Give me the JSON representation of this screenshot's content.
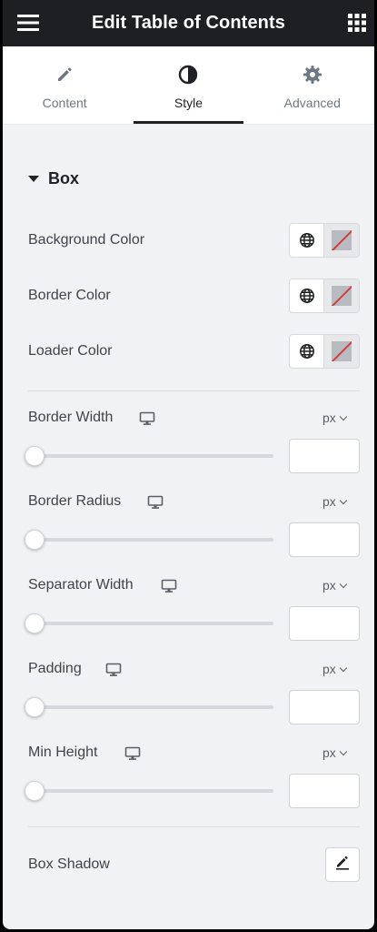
{
  "header": {
    "title": "Edit Table of Contents",
    "menu_icon": "hamburger-icon",
    "apps_icon": "grid-icon"
  },
  "tabs": [
    {
      "label": "Content",
      "icon": "pencil-icon",
      "active": false
    },
    {
      "label": "Style",
      "icon": "half-circle-icon",
      "active": true
    },
    {
      "label": "Advanced",
      "icon": "gear-icon",
      "active": false
    }
  ],
  "section": {
    "title": "Box",
    "expanded": true
  },
  "colors": [
    {
      "label": "Background Color"
    },
    {
      "label": "Border Color"
    },
    {
      "label": "Loader Color"
    }
  ],
  "sliders": [
    {
      "label": "Border Width",
      "unit": "px",
      "value": "",
      "level": 0
    },
    {
      "label": "Border Radius",
      "unit": "px",
      "value": "",
      "level": 0
    },
    {
      "label": "Separator Width",
      "unit": "px",
      "value": "",
      "level": 0
    },
    {
      "label": "Padding",
      "unit": "px",
      "value": "",
      "level": 0
    },
    {
      "label": "Min Height",
      "unit": "px",
      "value": "",
      "level": 0
    }
  ],
  "box_shadow": {
    "label": "Box Shadow",
    "icon": "pencil-icon"
  },
  "palette": {
    "header_bg": "#1d1f22",
    "panel_bg": "#f1f2f3",
    "active_tab": "#1f2124",
    "unset_color_slash": "#d63b3b"
  }
}
